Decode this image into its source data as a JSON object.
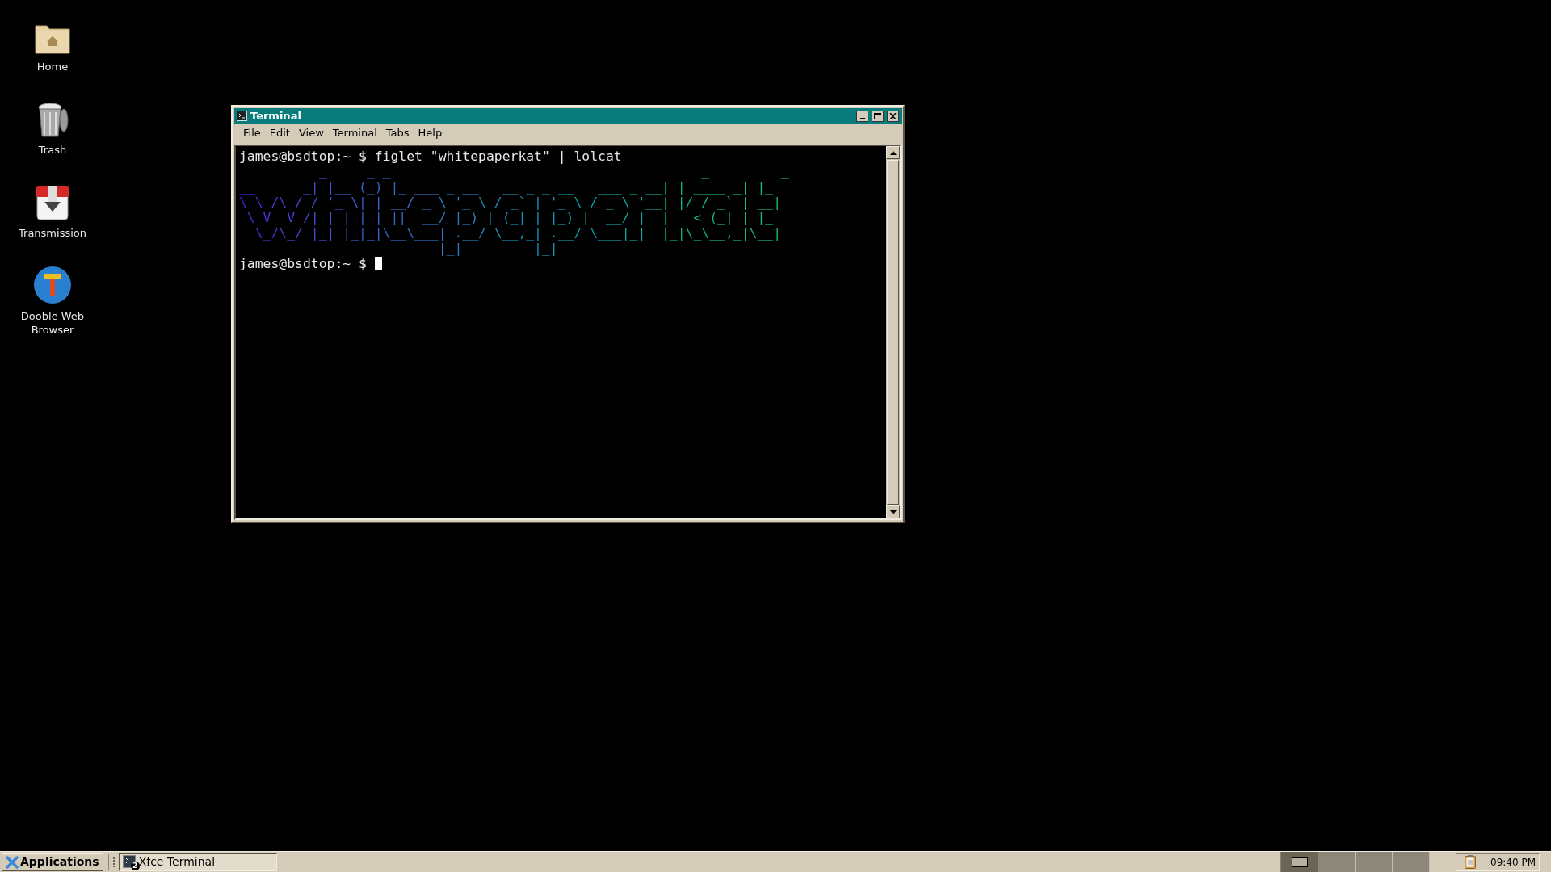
{
  "desktop_icons": [
    {
      "kind": "folder",
      "label": "Home"
    },
    {
      "kind": "trash",
      "label": "Trash"
    },
    {
      "kind": "download",
      "label": "Transmission"
    },
    {
      "kind": "globe",
      "label": "Dooble Web Browser"
    }
  ],
  "window": {
    "title": "Terminal",
    "menu": [
      "File",
      "Edit",
      "View",
      "Terminal",
      "Tabs",
      "Help"
    ]
  },
  "terminal": {
    "command_line": "james@bsdtop:~ $ figlet \"whitepaperkat\" | lolcat",
    "art": "          _     _ _                                       _         _   \n__      _| |__ (_) |_ ___ _ __   __ _ _ __   ___ _ __| | ____ _| |_ \n\\ \\ /\\ / / '_ \\| | __/ _ \\ '_ \\ / _` | '_ \\ / _ \\ '__| |/ / _` | __|\n \\ V  V /| | | | | ||  __/ |_) | (_| | |_) |  __/ |  |   < (_| | |_ \n  \\_/\\_/ |_| |_|_|\\__\\___| .__/ \\__,_| .__/ \\___|_|  |_|\\_\\__,_|\\__|\n                         |_|         |_|                            ",
    "prompt": "james@bsdtop:~ $"
  },
  "taskbar": {
    "menu_button": "Applications",
    "tasks": [
      {
        "label": "Xfce Terminal",
        "badge": "2"
      }
    ],
    "workspaces": [
      {
        "selected": true
      },
      {
        "selected": false
      },
      {
        "selected": false
      },
      {
        "selected": false
      }
    ],
    "clock": "09:40 PM"
  }
}
